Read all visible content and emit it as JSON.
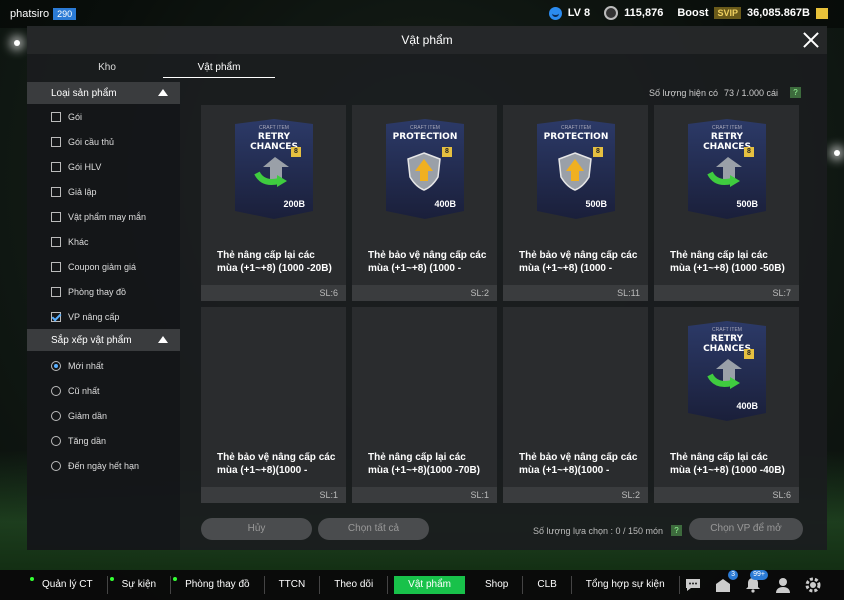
{
  "topbar": {
    "username": "phatsiro",
    "user_level": "290",
    "lv": "LV 8",
    "coins": "115,876",
    "boost": "Boost",
    "svip": "SVIP",
    "bp": "36,085.867B"
  },
  "panel": {
    "title": "Vật phẩm",
    "tabs": [
      {
        "label": "Kho"
      },
      {
        "label": "Vật phẩm"
      }
    ]
  },
  "sidebar": {
    "category_title": "Loại sản phẩm",
    "categories": [
      {
        "label": "Gói",
        "checked": false
      },
      {
        "label": "Gói cầu thủ",
        "checked": false
      },
      {
        "label": "Gói HLV",
        "checked": false
      },
      {
        "label": "Giả lập",
        "checked": false
      },
      {
        "label": "Vật phẩm may mắn",
        "checked": false
      },
      {
        "label": "Khác",
        "checked": false
      },
      {
        "label": "Coupon giảm giá",
        "checked": false
      },
      {
        "label": "Phòng thay đồ",
        "checked": false
      },
      {
        "label": "VP nâng cấp",
        "checked": true
      }
    ],
    "sort_title": "Sắp xếp vật phẩm",
    "sort_options": [
      {
        "label": "Mới nhất",
        "selected": true
      },
      {
        "label": "Cũ nhất",
        "selected": false
      },
      {
        "label": "Giảm dần",
        "selected": false
      },
      {
        "label": "Tăng dần",
        "selected": false
      },
      {
        "label": "Đến ngày hết hạn",
        "selected": false
      }
    ]
  },
  "inventory": {
    "count_label": "Số lượng hiện có",
    "count_value": "73 / 1.000 cái",
    "help": "?"
  },
  "items": [
    {
      "card_head": "CRAFT ITEM",
      "card_title": "RETRY CHANCES",
      "badge": "8",
      "value": "200B",
      "type": "retry",
      "name": "Thẻ nâng cấp lại các mùa (+1~+8) (1000 -20B)",
      "qty": "SL:6"
    },
    {
      "card_head": "CRAFT ITEM",
      "card_title": "PROTECTION",
      "badge": "8",
      "value": "400B",
      "type": "protection",
      "name": "Thẻ bảo vệ nâng cấp các mùa (+1~+8) (1000 -",
      "qty": "SL:2"
    },
    {
      "card_head": "CRAFT ITEM",
      "card_title": "PROTECTION",
      "badge": "8",
      "value": "500B",
      "type": "protection",
      "name": "Thẻ bảo vệ nâng cấp các mùa (+1~+8) (1000 -",
      "qty": "SL:11"
    },
    {
      "card_head": "CRAFT ITEM",
      "card_title": "RETRY CHANCES",
      "badge": "8",
      "value": "500B",
      "type": "retry",
      "name": "Thẻ nâng cấp lại các mùa (+1~+8) (1000 -50B)",
      "qty": "SL:7"
    },
    {
      "card_head": "",
      "card_title": "",
      "badge": "",
      "value": "",
      "type": "empty",
      "name": "Thẻ bảo vệ nâng cấp các mùa (+1~+8)(1000 -",
      "qty": "SL:1"
    },
    {
      "card_head": "",
      "card_title": "",
      "badge": "",
      "value": "",
      "type": "empty",
      "name": "Thẻ nâng cấp lại các mùa (+1~+8)(1000 -70B)",
      "qty": "SL:1"
    },
    {
      "card_head": "",
      "card_title": "",
      "badge": "",
      "value": "",
      "type": "empty",
      "name": "Thẻ bảo vệ nâng cấp các mùa (+1~+8)(1000 -",
      "qty": "SL:2"
    },
    {
      "card_head": "CRAFT ITEM",
      "card_title": "RETRY CHANCES",
      "badge": "8",
      "value": "400B",
      "type": "retry",
      "name": "Thẻ nâng cấp lại các mùa (+1~+8) (1000 -40B)",
      "qty": "SL:6"
    }
  ],
  "actions": {
    "cancel": "Hủy",
    "select_all": "Chọn tất cả",
    "selected_label": "Số lượng lựa chọn : 0 / 150 món",
    "confirm": "Chọn VP để mở"
  },
  "bottomnav": [
    {
      "label": "Quản lý CT",
      "dot": true,
      "active": false
    },
    {
      "label": "Sự kiện",
      "dot": true,
      "active": false
    },
    {
      "label": "Phòng thay đồ",
      "dot": true,
      "active": false
    },
    {
      "label": "TTCN",
      "dot": false,
      "active": false
    },
    {
      "label": "Theo dõi",
      "dot": false,
      "active": false
    },
    {
      "label": "Vật phẩm",
      "dot": false,
      "active": true
    },
    {
      "label": "Shop",
      "dot": false,
      "active": false
    },
    {
      "label": "CLB",
      "dot": false,
      "active": false
    },
    {
      "label": "Tổng hợp sự kiện",
      "dot": false,
      "active": false
    }
  ],
  "nav_icons": {
    "chat_icon": "chat-icon",
    "mail_badge": "3",
    "notif_badge": "99+",
    "profile_icon": "profile-icon",
    "settings_icon": "gear-icon"
  },
  "colors": {
    "accent_green": "#18c24a",
    "accent_blue": "#2b7bd6",
    "panel_bg": "#1a1c1e",
    "card_bg": "#2a2c2e"
  }
}
